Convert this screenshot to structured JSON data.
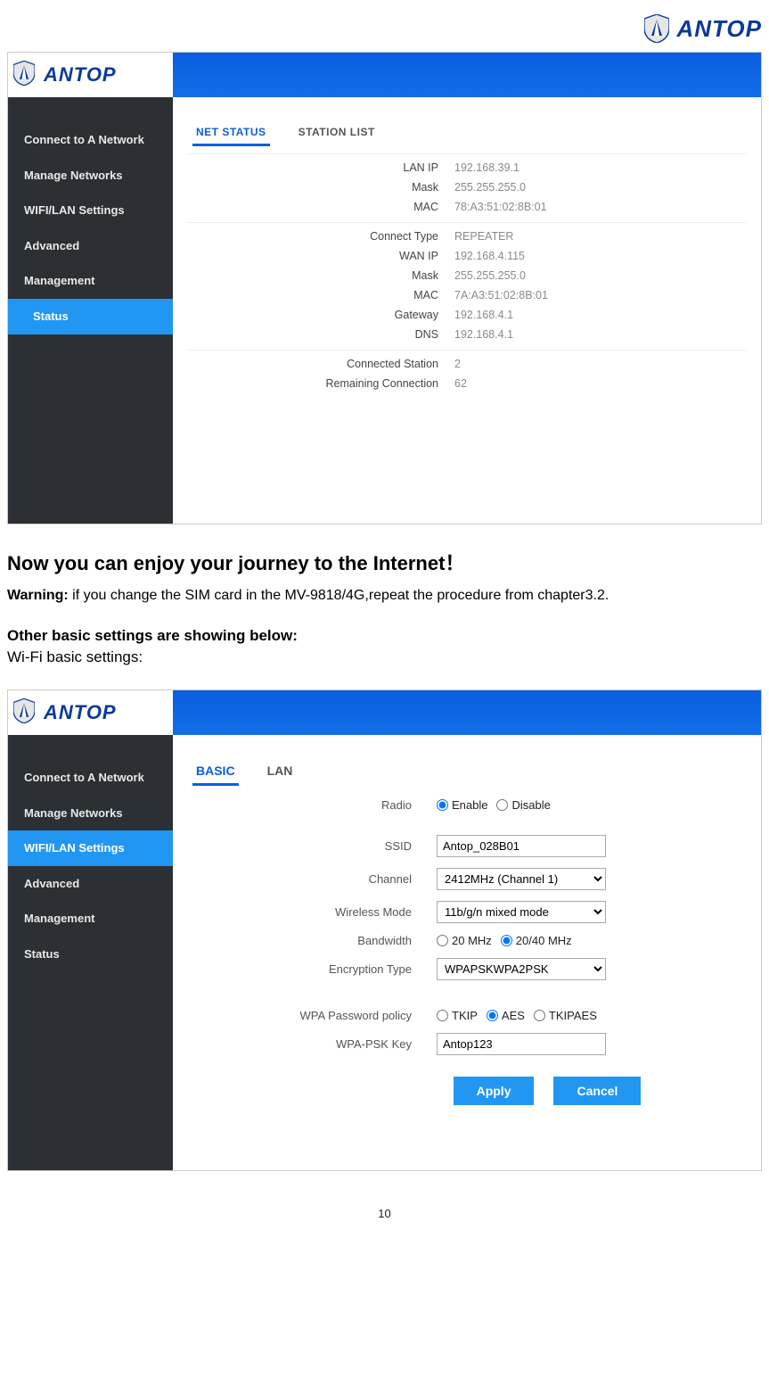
{
  "brand": {
    "name": "ANTOP"
  },
  "panel1": {
    "sidebar": {
      "items": [
        {
          "label": "Connect to A Network"
        },
        {
          "label": "Manage Networks"
        },
        {
          "label": "WIFI/LAN Settings"
        },
        {
          "label": "Advanced"
        },
        {
          "label": "Management"
        },
        {
          "label": "Status"
        }
      ],
      "active_index": 5
    },
    "tabs": [
      {
        "label": "NET STATUS"
      },
      {
        "label": "STATION LIST"
      }
    ],
    "tabs_active_index": 0,
    "status": {
      "group_lan": [
        {
          "label": "LAN IP",
          "value": "192.168.39.1"
        },
        {
          "label": "Mask",
          "value": "255.255.255.0"
        },
        {
          "label": "MAC",
          "value": "78:A3:51:02:8B:01"
        }
      ],
      "group_wan": [
        {
          "label": "Connect Type",
          "value": "REPEATER"
        },
        {
          "label": "WAN IP",
          "value": "192.168.4.115"
        },
        {
          "label": "Mask",
          "value": "255.255.255.0"
        },
        {
          "label": "MAC",
          "value": "7A:A3:51:02:8B:01"
        },
        {
          "label": "Gateway",
          "value": "192.168.4.1"
        },
        {
          "label": "DNS",
          "value": "192.168.4.1"
        }
      ],
      "group_conn": [
        {
          "label": "Connected Station",
          "value": "2"
        },
        {
          "label": "Remaining Connection",
          "value": "62"
        }
      ]
    }
  },
  "prose": {
    "headline": "Now you can enjoy your journey to the Internet！",
    "warning_label": "Warning:",
    "warning_text": " if you change the SIM card in the MV-9818/4G,repeat the procedure from chapter3.2.",
    "other_heading": "Other basic settings are showing below:",
    "wifi_sub": "Wi-Fi basic settings:"
  },
  "panel2": {
    "sidebar": {
      "items": [
        {
          "label": "Connect to A Network"
        },
        {
          "label": "Manage Networks"
        },
        {
          "label": "WIFI/LAN Settings"
        },
        {
          "label": "Advanced"
        },
        {
          "label": "Management"
        },
        {
          "label": "Status"
        }
      ],
      "active_index": 2
    },
    "tabs": [
      {
        "label": "BASIC"
      },
      {
        "label": "LAN"
      }
    ],
    "tabs_active_index": 0,
    "form": {
      "radio": {
        "label": "Radio",
        "options": [
          {
            "label": "Enable",
            "checked": true
          },
          {
            "label": "Disable",
            "checked": false
          }
        ]
      },
      "ssid": {
        "label": "SSID",
        "value": "Antop_028B01"
      },
      "channel": {
        "label": "Channel",
        "value": "2412MHz (Channel 1)"
      },
      "mode": {
        "label": "Wireless Mode",
        "value": "11b/g/n mixed mode"
      },
      "bandwidth": {
        "label": "Bandwidth",
        "options": [
          {
            "label": "20 MHz",
            "checked": false
          },
          {
            "label": "20/40 MHz",
            "checked": true
          }
        ]
      },
      "enc": {
        "label": "Encryption Type",
        "value": "WPAPSKWPA2PSK"
      },
      "wpa_policy": {
        "label": "WPA Password policy",
        "options": [
          {
            "label": "TKIP",
            "checked": false
          },
          {
            "label": "AES",
            "checked": true
          },
          {
            "label": "TKIPAES",
            "checked": false
          }
        ]
      },
      "wpa_key": {
        "label": "WPA-PSK Key",
        "value": "Antop123"
      },
      "apply_label": "Apply",
      "cancel_label": "Cancel"
    }
  },
  "page_number": "10"
}
